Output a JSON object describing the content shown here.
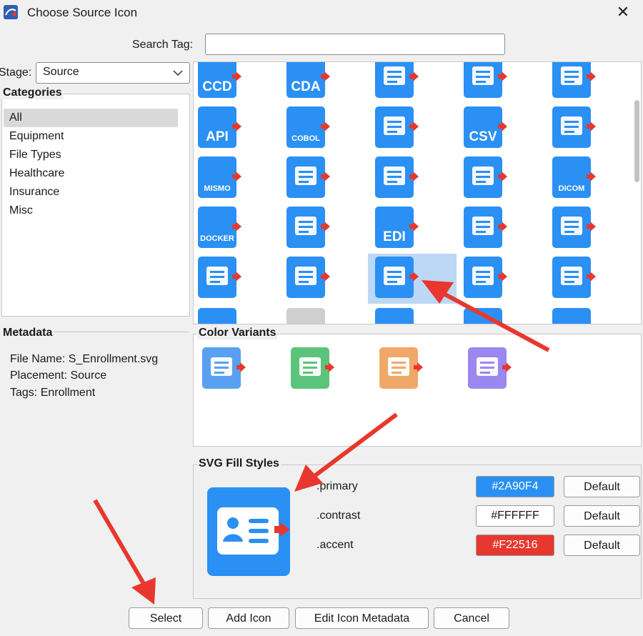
{
  "window": {
    "title": "Choose Source Icon",
    "app_icon": "app-logo-icon",
    "close_glyph": "✕"
  },
  "search": {
    "label": "Search Tag:",
    "value": "",
    "placeholder": ""
  },
  "stage": {
    "label": "Stage:",
    "value": "Source"
  },
  "categories": {
    "title": "Categories",
    "items": [
      "All",
      "Equipment",
      "File Types",
      "Healthcare",
      "Insurance",
      "Misc"
    ],
    "selected": "All"
  },
  "icon_grid": {
    "tiles": [
      {
        "label": "CCD",
        "name": "ccd-icon"
      },
      {
        "label": "CDA",
        "name": "cda-icon"
      },
      {
        "label": "",
        "name": "flowchart-document-icon"
      },
      {
        "label": "",
        "name": "hospital-icon"
      },
      {
        "label": "",
        "name": "cloud-network-icon"
      },
      {
        "label": "API",
        "name": "api-cloud-icon"
      },
      {
        "label": "COBOL",
        "name": "cobol-icon"
      },
      {
        "label": "",
        "name": "people-network-icon"
      },
      {
        "label": "CSV",
        "name": "csv-icon"
      },
      {
        "label": "",
        "name": "database-cloud-icon"
      },
      {
        "label": "MISMO",
        "name": "mismo-icon"
      },
      {
        "label": "",
        "name": "warehouse-database-icon"
      },
      {
        "label": "",
        "name": "server-rack-icon"
      },
      {
        "label": "",
        "name": "medical-equipment-icon"
      },
      {
        "label": "DICOM",
        "name": "dicom-icon"
      },
      {
        "label": "DOCKER",
        "name": "docker-icon"
      },
      {
        "label": "",
        "name": "shopping-cart-document-icon"
      },
      {
        "label": "EDI",
        "name": "edi-icon"
      },
      {
        "label": "",
        "name": "medical-laptop-icon"
      },
      {
        "label": "",
        "name": "id-card-shield-icon"
      },
      {
        "label": "",
        "name": "id-card-icon"
      },
      {
        "label": "",
        "name": "building-shield-icon"
      },
      {
        "label": "",
        "name": "enrollment-icon"
      },
      {
        "label": "",
        "name": "gear-device-icon"
      },
      {
        "label": "",
        "name": "factory-icon"
      }
    ],
    "selected_index": 22
  },
  "metadata": {
    "title": "Metadata",
    "file_name": "File Name: S_Enrollment.svg",
    "placement": "Placement: Source",
    "tags": "Tags: Enrollment"
  },
  "color_variants": {
    "title": "Color Variants",
    "colors": [
      "#5aa0f0",
      "#5cc47a",
      "#f0a868",
      "#9b87f0"
    ]
  },
  "svg_fill_styles": {
    "title": "SVG Fill Styles",
    "rows": [
      {
        "name": ".primary",
        "value": "#2A90F4",
        "bg": "#2a90f4",
        "fg": "#ffffff",
        "default_label": "Default"
      },
      {
        "name": ".contrast",
        "value": "#FFFFFF",
        "bg": "#ffffff",
        "fg": "#1a1a1a",
        "default_label": "Default"
      },
      {
        "name": ".accent",
        "value": "#F22516",
        "bg": "#e8372e",
        "fg": "#ffffff",
        "default_label": "Default"
      }
    ]
  },
  "buttons": {
    "select": "Select",
    "add_icon": "Add Icon",
    "edit_metadata": "Edit Icon Metadata",
    "cancel": "Cancel"
  },
  "colors": {
    "icon_blue": "#2a90f4",
    "arrow_red": "#e8372e",
    "selection": "#bcd8f4"
  }
}
